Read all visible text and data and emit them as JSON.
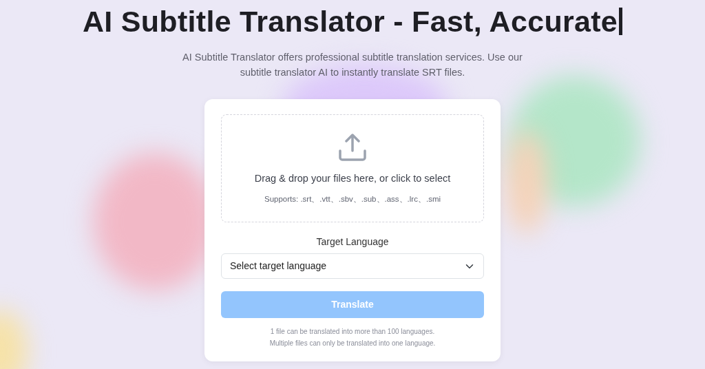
{
  "hero": {
    "title": "AI Subtitle Translator - Fast, Accurate",
    "typing_cursor": true,
    "description": "AI Subtitle Translator offers professional subtitle translation services. Use our subtitle translator AI to instantly translate SRT files."
  },
  "upload": {
    "prompt": "Drag & drop your files here, or click to select",
    "supports": "Supports: .srt、.vtt、.sbv、.sub、.ass、.lrc、.smi"
  },
  "target_language": {
    "label": "Target Language",
    "placeholder": "Select target language"
  },
  "translate_button": {
    "label": "Translate",
    "disabled": true
  },
  "notes": [
    "1 file can be translated into more than 100 languages.",
    "Multiple files can only be translated into one language."
  ]
}
